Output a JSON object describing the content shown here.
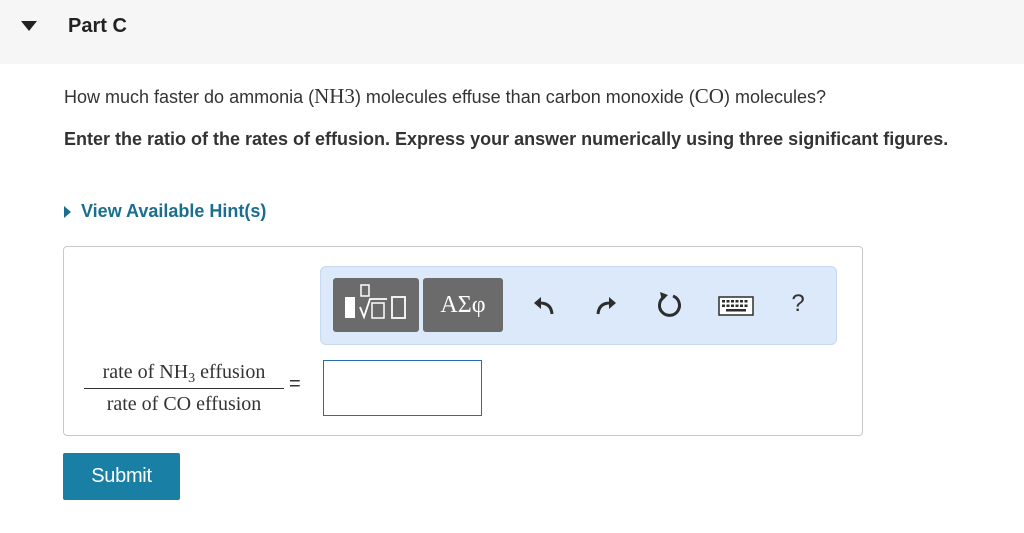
{
  "part": {
    "title": "Part C"
  },
  "question": {
    "prefix": "How much faster do ammonia (",
    "formula1": "NH3",
    "middle": ") molecules effuse than carbon monoxide (",
    "formula2": "CO",
    "suffix": ") molecules?"
  },
  "instructions": "Enter the ratio of the rates of effusion. Express your answer numerically using three significant figures.",
  "hint": {
    "label": "View Available Hint(s)"
  },
  "toolbar": {
    "greek_label": "ΑΣφ",
    "help_label": "?",
    "icons": [
      "templates-icon",
      "undo-icon",
      "redo-icon",
      "reset-icon",
      "keyboard-icon",
      "help-icon"
    ]
  },
  "equation": {
    "numerator_prefix": "rate of NH",
    "numerator_sub": "3",
    "numerator_suffix": " effusion",
    "denominator": "rate of CO effusion",
    "equals": "="
  },
  "answer": {
    "value": ""
  },
  "submit": {
    "label": "Submit"
  },
  "colors": {
    "accent": "#1a7fa5",
    "link": "#1a6e8e",
    "toolbar_bg": "#dbe9fa",
    "input_border": "#2a6bb1"
  }
}
